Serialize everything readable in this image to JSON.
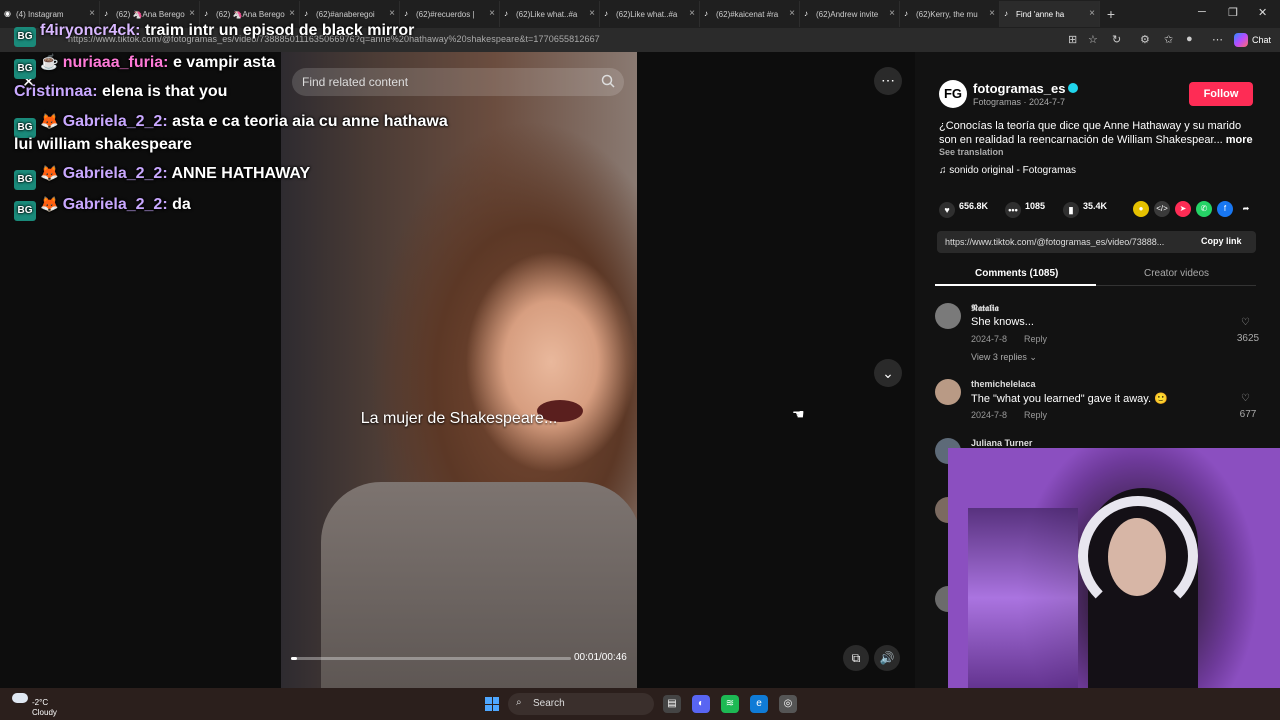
{
  "browser": {
    "tabs": [
      {
        "label": "(4) Instagram",
        "icon": "instagram-icon"
      },
      {
        "label": "(62) 🦄Ana Berego",
        "icon": "tiktok-icon"
      },
      {
        "label": "(62) 🦄Ana Berego",
        "icon": "tiktok-icon"
      },
      {
        "label": "(62)#anaberegoi",
        "icon": "tiktok-icon"
      },
      {
        "label": "(62)#recuerdos |",
        "icon": "tiktok-icon"
      },
      {
        "label": "(62)Like what..#a",
        "icon": "tiktok-icon"
      },
      {
        "label": "(62)Like what..#a",
        "icon": "tiktok-icon"
      },
      {
        "label": "(62)#kaicenat #ra",
        "icon": "tiktok-icon"
      },
      {
        "label": "(62)Andrew invite",
        "icon": "tiktok-icon"
      },
      {
        "label": "(62)Kerry, the mu",
        "icon": "tiktok-icon"
      },
      {
        "label": "Find 'anne ha",
        "icon": "tiktok-icon"
      }
    ],
    "url": "https://www.tiktok.com/@fotogramas_es/video/7388850111635066976?q=anne%20hathaway%20shakespeare&t=1770655812667",
    "chat_label": "Chat"
  },
  "stream_chat": [
    {
      "user": "f4iryoncr4ck:",
      "message": "traim intr un episod de black mirror",
      "user_color": "lav"
    },
    {
      "user": "nuriaaa_furia:",
      "message": "e vampir asta",
      "user_color": "pink"
    },
    {
      "user": "Cristinnaa:",
      "message": "elena is that you",
      "user_color": "purple"
    },
    {
      "user": "Gabriela_2_2:",
      "message": "asta e ca teoria aia cu anne hathawa",
      "message2": "lui william shakespeare",
      "user_color": "purple"
    },
    {
      "user": "Gabriela_2_2:",
      "message": "ANNE HATHAWAY",
      "user_color": "purple"
    },
    {
      "user": "Gabriela_2_2:",
      "message": "da",
      "user_color": "purple"
    }
  ],
  "video": {
    "search_placeholder": "Find related content",
    "caption": "La mujer de Shakespeare...",
    "timecode": "00:01/00:46",
    "progress": 0.02
  },
  "post": {
    "account_name": "fotogramas_es",
    "account_initials": "FG",
    "account_sub": "Fotogramas · 2024-7-7",
    "follow_label": "Follow",
    "description": "¿Conocías la teoría que dice que Anne Hathaway y su marido son en realidad la reencarnación de William Shakespear...",
    "more_label": "more",
    "see_translation": "See translation",
    "sound": "♫  sonido original - Fotogramas",
    "likes": "656.8K",
    "comments": "1085",
    "saves": "35.4K",
    "link": "https://www.tiktok.com/@fotogramas_es/video/73888...",
    "copy_link": "Copy link",
    "tab_comments": "Comments (1085)",
    "tab_creator": "Creator videos"
  },
  "comments": [
    {
      "user": "𝕹𝖆𝖙𝖆𝖑𝖎𝖆",
      "text": "She knows...",
      "date": "2024-7-8",
      "reply": "Reply",
      "likes": "3625",
      "views": "View 3 replies ⌄"
    },
    {
      "user": "themichelelaca",
      "text": "The \"what you learned\" gave it away. 🙂",
      "date": "2024-7-8",
      "reply": "Reply",
      "likes": "677",
      "views": ""
    },
    {
      "user": "Juliana Turner",
      "text": "",
      "date": "",
      "reply": "",
      "likes": "",
      "views": ""
    }
  ],
  "taskbar": {
    "weather_temp": "-2°C",
    "weather_desc": "Cloudy",
    "search_label": "Search"
  },
  "colors": {
    "follow": "#fe2c55",
    "verified": "#20d5ec",
    "chat_badge": "#1a8a7a"
  }
}
